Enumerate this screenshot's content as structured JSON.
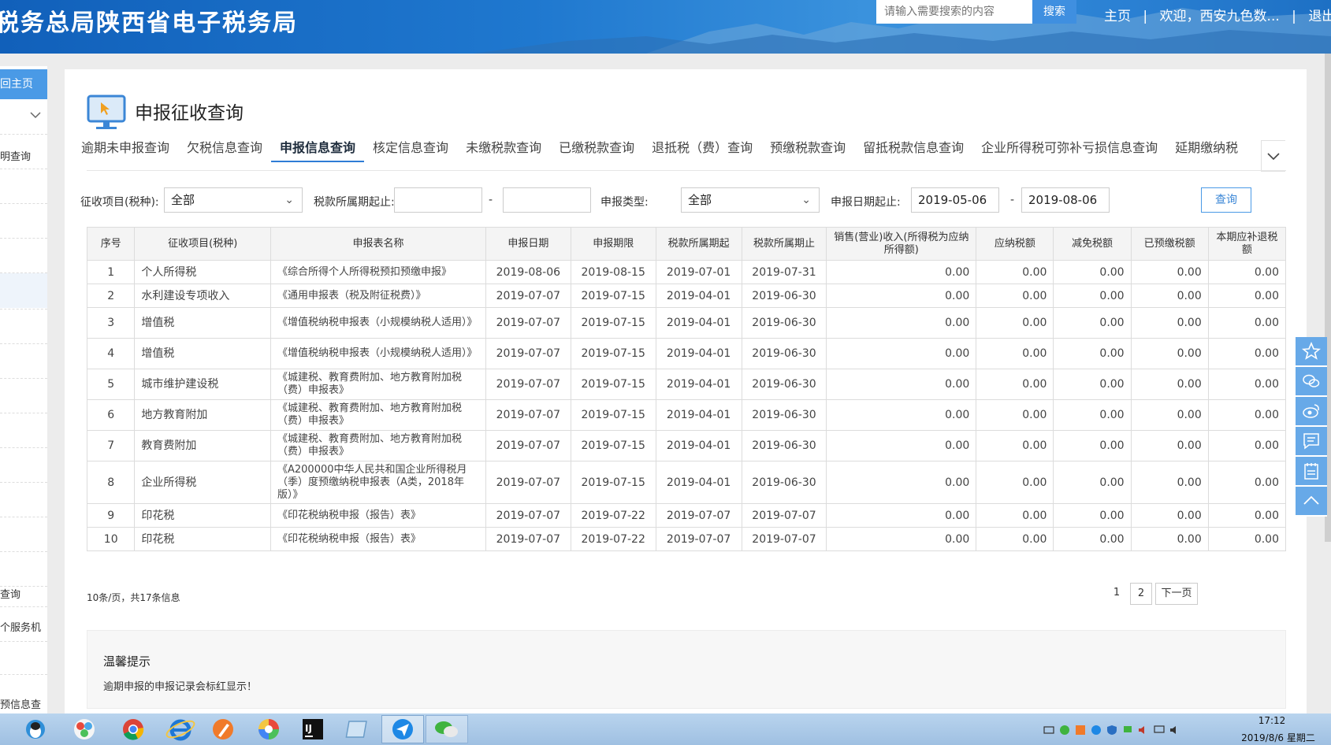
{
  "header": {
    "title": "税务总局陕西省电子税务局",
    "search_placeholder": "请输入需要搜索的内容",
    "search_button": "搜索",
    "nav_home": "主页",
    "separator": "|",
    "welcome": "欢迎，西安九色数...",
    "logout": "退出"
  },
  "sidebar": {
    "home": "回主页",
    "items": [
      "明查询",
      "查询",
      "个服务机",
      "预信息查"
    ]
  },
  "page": {
    "title": "申报征收查询",
    "tabs": [
      "逾期未申报查询",
      "欠税信息查询",
      "申报信息查询",
      "核定信息查询",
      "未缴税款查询",
      "已缴税款查询",
      "退抵税（费）查询",
      "预缴税款查询",
      "留抵税款信息查询",
      "企业所得税可弥补亏损信息查询",
      "延期缴纳税"
    ],
    "active_tab": 2
  },
  "filters": {
    "item_label": "征收项目(税种):",
    "item_value": "全部",
    "period_label": "税款所属期起止:",
    "period_start": "",
    "period_end": "",
    "dash": "-",
    "type_label": "申报类型:",
    "type_value": "全部",
    "date_label": "申报日期起止:",
    "date_start": "2019-05-06",
    "date_end": "2019-08-06",
    "query_button": "查询"
  },
  "table": {
    "headers": [
      "序号",
      "征收项目(税种)",
      "申报表名称",
      "申报日期",
      "申报期限",
      "税款所属期起",
      "税款所属期止",
      "销售(营业)收入(所得税为应纳所得额)",
      "应纳税额",
      "减免税额",
      "已预缴税额",
      "本期应补退税额"
    ],
    "rows": [
      [
        "1",
        "个人所得税",
        "《综合所得个人所得税预扣预缴申报》",
        "2019-08-06",
        "2019-08-15",
        "2019-07-01",
        "2019-07-31",
        "0.00",
        "0.00",
        "0.00",
        "0.00",
        "0.00"
      ],
      [
        "2",
        "水利建设专项收入",
        "《通用申报表（税及附征税费）》",
        "2019-07-07",
        "2019-07-15",
        "2019-04-01",
        "2019-06-30",
        "0.00",
        "0.00",
        "0.00",
        "0.00",
        "0.00"
      ],
      [
        "3",
        "增值税",
        "《增值税纳税申报表（小规模纳税人适用）》",
        "2019-07-07",
        "2019-07-15",
        "2019-04-01",
        "2019-06-30",
        "0.00",
        "0.00",
        "0.00",
        "0.00",
        "0.00"
      ],
      [
        "4",
        "增值税",
        "《增值税纳税申报表（小规模纳税人适用）》",
        "2019-07-07",
        "2019-07-15",
        "2019-04-01",
        "2019-06-30",
        "0.00",
        "0.00",
        "0.00",
        "0.00",
        "0.00"
      ],
      [
        "5",
        "城市维护建设税",
        "《城建税、教育费附加、地方教育附加税（费）申报表》",
        "2019-07-07",
        "2019-07-15",
        "2019-04-01",
        "2019-06-30",
        "0.00",
        "0.00",
        "0.00",
        "0.00",
        "0.00"
      ],
      [
        "6",
        "地方教育附加",
        "《城建税、教育费附加、地方教育附加税（费）申报表》",
        "2019-07-07",
        "2019-07-15",
        "2019-04-01",
        "2019-06-30",
        "0.00",
        "0.00",
        "0.00",
        "0.00",
        "0.00"
      ],
      [
        "7",
        "教育费附加",
        "《城建税、教育费附加、地方教育附加税（费）申报表》",
        "2019-07-07",
        "2019-07-15",
        "2019-04-01",
        "2019-06-30",
        "0.00",
        "0.00",
        "0.00",
        "0.00",
        "0.00"
      ],
      [
        "8",
        "企业所得税",
        "《A200000中华人民共和国企业所得税月（季）度预缴纳税申报表（A类，2018年版）》",
        "2019-07-07",
        "2019-07-15",
        "2019-04-01",
        "2019-06-30",
        "0.00",
        "0.00",
        "0.00",
        "0.00",
        "0.00"
      ],
      [
        "9",
        "印花税",
        "《印花税纳税申报（报告）表》",
        "2019-07-07",
        "2019-07-22",
        "2019-07-07",
        "2019-07-07",
        "0.00",
        "0.00",
        "0.00",
        "0.00",
        "0.00"
      ],
      [
        "10",
        "印花税",
        "《印花税纳税申报（报告）表》",
        "2019-07-07",
        "2019-07-22",
        "2019-07-07",
        "2019-07-07",
        "0.00",
        "0.00",
        "0.00",
        "0.00",
        "0.00"
      ]
    ]
  },
  "pager": {
    "summary": "10条/页，共17条信息",
    "page1": "1",
    "page2": "2",
    "next": "下一页"
  },
  "tip": {
    "title": "温馨提示",
    "text": "逾期申报的申报记录会标红显示！"
  },
  "taskbar": {
    "time": "17:12",
    "date": "2019/8/6 星期二"
  },
  "colors": {
    "header_blue": "#1f78cf",
    "accent_blue": "#4a9ae6",
    "tab_underline": "#2f7cd6"
  }
}
